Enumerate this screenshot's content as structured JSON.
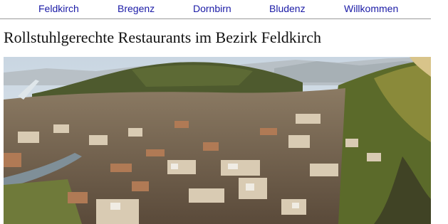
{
  "nav": {
    "items": [
      {
        "label": "Feldkirch"
      },
      {
        "label": "Bregenz"
      },
      {
        "label": "Dornbirn"
      },
      {
        "label": "Bludenz"
      },
      {
        "label": "Willkommen"
      }
    ]
  },
  "page": {
    "title": "Rollstuhlgerechte Restaurants im Bezirk Feldkirch"
  },
  "colors": {
    "link": "#1a1aa6",
    "divider": "#9a9a9a",
    "text": "#111111"
  }
}
